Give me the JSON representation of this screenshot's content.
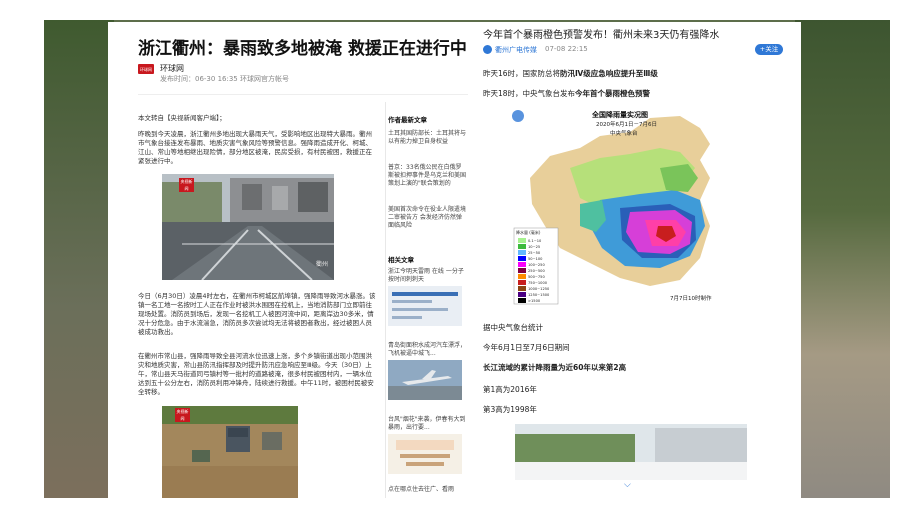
{
  "left": {
    "title": "浙江衢州：暴雨致多地被淹 救援正在进行中",
    "source_logo": "环球网",
    "source_name": "环球网",
    "meta": "发布时间：06-30 16:35   环球网官方帐号",
    "intro": "本文转自【央视新闻客户端】；",
    "para1": "昨晚到今天凌晨，浙江衢州多地出现大暴雨天气，受影响地区出现特大暴雨。衢州市气象台接连发布暴雨、地质灾害气象风险等预警信息。强降雨造成开化、柯城、江山、常山等地相继出现险情，部分地区被淹，民房受损，有村民被困，救援正在紧张进行中。",
    "para2": "今日（6月30日）凌晨4时左右，在衢州市柯城区航埠镇，强降雨导致河水暴涨。该镇一名工地一名按时工人正在作业时被洪水围困在控机上，当地消防部门立即前往现场处置。消防员到场后，发现一名挖机工人被困河流中间，距离岸边30多米，情况十分危急。由于水流湍急，消防员多次尝试均无法将被困者救出，经过被困人员被成功救出。",
    "para3": "在衢州市常山县，强降雨导致全县河流水位迅速上涨，多个乡镇街道出现小范围洪灾和地质灾害，常山县防汛指挥部及时提升防汛应急响应至Ⅲ级。今天（30日）上午，常山县天马街道同弓镇村等一批村的道路被淹，很多村民被困村内，一辆水位达到五十公分左右，消防员利用冲锋舟，陆续进行救援。中午11时，被困村民被安全转移。",
    "photo_badge1": "央视新闻",
    "photo_badge2": "央视新闻",
    "watermark": "衢州",
    "sidebar": {
      "recent_heading": "作者最新文章",
      "recent": [
        "土耳其国防部长：土耳其将与以有能力掉卫自身权益",
        "普京：33名俄公民在白俄罗斯被扣押事件是乌克兰和美国策划上演的\"联合策划的",
        "美国首次命令在役业人限遣境二审被告方 会发经济仿然弹面临风险"
      ],
      "related_heading": "相关文章",
      "related": [
        "浙江今明天雷雨 在线 一分子按时间刺刺天",
        "青岛街面积水成河汽车漂浮，飞机被逼中城飞...",
        "台风\"烟花\"来袭，伊春有大到暴雨，出行要...",
        "点在哪点住去往广、看雨"
      ]
    }
  },
  "right": {
    "title": "今年首个暴雨橙色预警发布！衢州未来3天仍有强降水",
    "source": "衢州广电传媒",
    "time": "07-08 22:15",
    "follow": "+关注",
    "line1_prefix": "昨天16时，国家防总将",
    "line1_bold": "防汛Ⅳ级应急响应提升至Ⅲ级",
    "line2_prefix": "昨天18时，中央气象台发布",
    "line2_bold": "今年首个暴雨橙色预警",
    "map_title": "全国降雨量实况图",
    "map_subtitle": "2020年6月1日－7月6日",
    "map_org": "中央气象台",
    "map_footer": "7月7日10时制作",
    "legend_title": "降水量 (毫米)",
    "legend_items": [
      "0.1~10",
      "10~25",
      "25~50",
      "50~100",
      "100~250",
      "250~500",
      "500~750",
      "750~1000",
      "1000~1250",
      "1250~1500",
      ">1500"
    ],
    "stats_intro": "据中央气象台统计",
    "stats_period": "今年6月1日至7月6日期间",
    "stats_bold": "长江流域的累计降雨量为近60年以来第2高",
    "stats_first": "第1高为2016年",
    "stats_third": "第3高为1998年"
  }
}
